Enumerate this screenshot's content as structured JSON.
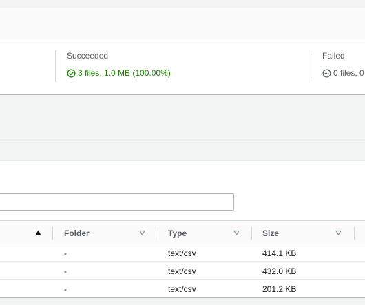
{
  "summary": {
    "succeeded_label": "Succeeded",
    "succeeded_value": "3 files, 1.0 MB (100.00%)",
    "failed_label": "Failed",
    "failed_value": "0 files, 0"
  },
  "filter": {
    "placeholder": ""
  },
  "table": {
    "columns": [
      {
        "label": "",
        "sort": "ascending"
      },
      {
        "label": "Folder",
        "sort": "none"
      },
      {
        "label": "Type",
        "sort": "none"
      },
      {
        "label": "Size",
        "sort": "none"
      }
    ],
    "rows": [
      {
        "folder": "-",
        "type": "text/csv",
        "size": "414.1 KB"
      },
      {
        "folder": "-",
        "type": "text/csv",
        "size": "432.0 KB"
      },
      {
        "folder": "-",
        "type": "text/csv",
        "size": "201.2 KB"
      }
    ]
  },
  "colors": {
    "success": "#1d8102",
    "neutral": "#545b64",
    "border": "#aab7b8"
  },
  "icons": {
    "success": "check-circle-icon",
    "failed": "dash-circle-icon",
    "sort_active": "sort-ascending-icon",
    "sort_inactive": "sort-caret-down-icon"
  }
}
